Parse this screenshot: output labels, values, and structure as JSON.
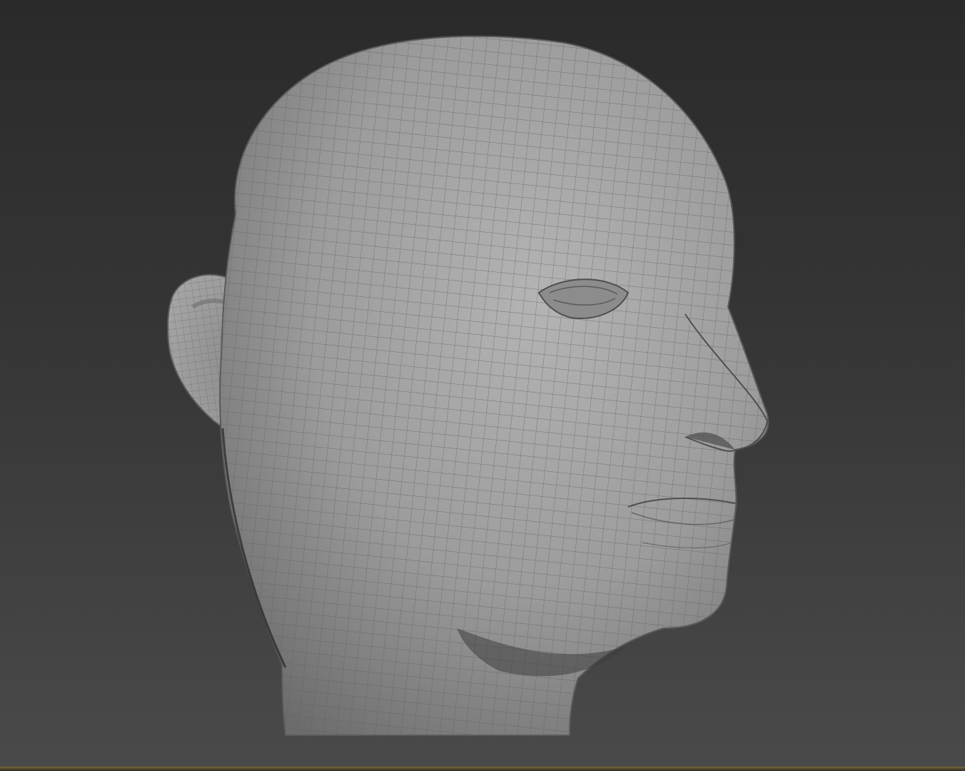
{
  "viewport": {
    "view_mode": "perspective",
    "display_mode": "shaded-wireframe",
    "background_top_color": "#2a2a2a",
    "background_bottom_color": "#4a4a4a",
    "border_accent_color": "#7a6a3a"
  },
  "model": {
    "object": "head-mesh",
    "surface_color": "#9a9a9a",
    "wire_color": "#6a6a6a"
  }
}
